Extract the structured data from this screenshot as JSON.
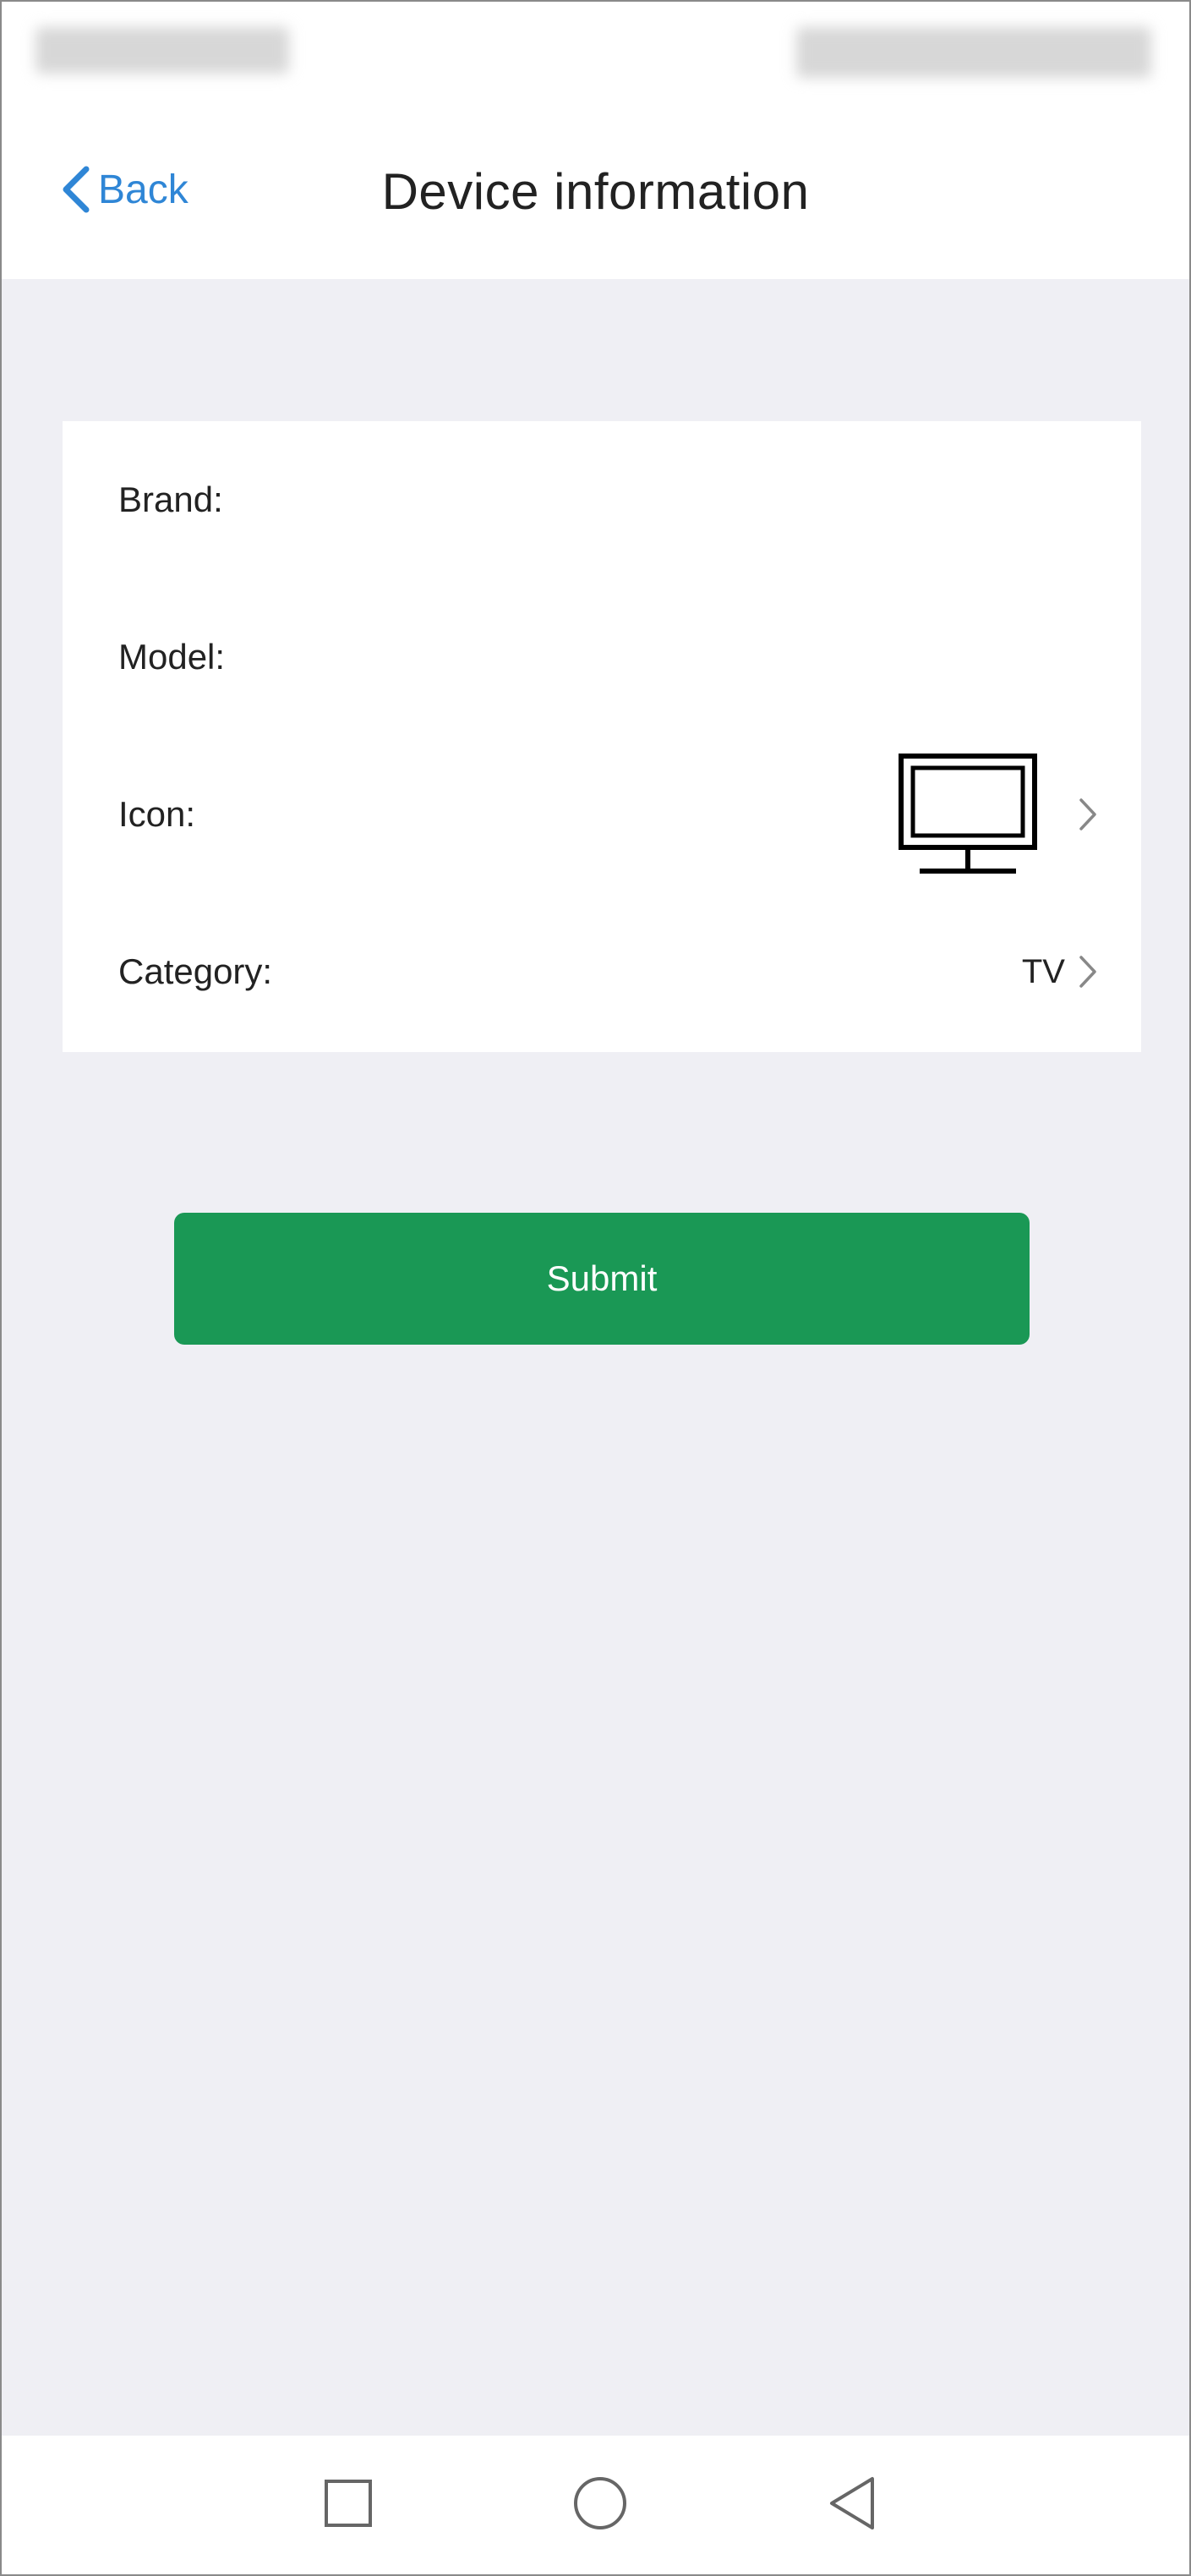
{
  "header": {
    "back_label": "Back",
    "title": "Device information"
  },
  "device_form": {
    "rows": [
      {
        "label": "Brand:",
        "value": ""
      },
      {
        "label": "Model:",
        "value": ""
      },
      {
        "label": "Icon:",
        "icon": "tv-icon"
      },
      {
        "label": "Category:",
        "value": "TV"
      }
    ]
  },
  "submit": {
    "label": "Submit"
  },
  "navigation": {
    "icons": [
      "recent-apps-icon",
      "home-icon",
      "back-icon"
    ]
  },
  "colors": {
    "accent_blue": "#2f86d6",
    "submit_green": "#1a9855",
    "background": "#efeff4",
    "text": "#222222"
  }
}
